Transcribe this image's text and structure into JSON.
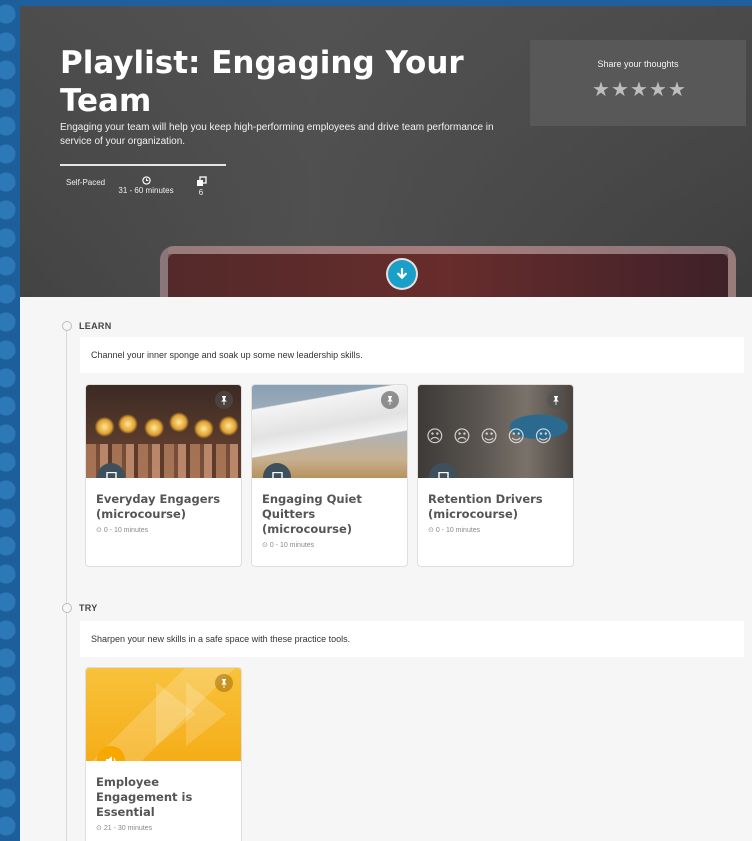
{
  "hero": {
    "title": "Playlist: Engaging Your Team",
    "description": "Engaging your team will help you keep high-performing employees and drive team performance in service of your organization.",
    "pace": "Self-Paced",
    "duration": "31 - 60 minutes",
    "item_count": "6",
    "rating_label": "Share your thoughts",
    "rating_stars": 5
  },
  "sections": [
    {
      "label": "LEARN",
      "description": "Channel your inner sponge and soak up some new leadership skills.",
      "cards": [
        {
          "title": "Everyday Engagers (microcourse)",
          "duration": "0 - 10 minutes",
          "type_icon": "laptop-icon"
        },
        {
          "title": "Engaging Quiet Quitters (microcourse)",
          "duration": "0 - 10 minutes",
          "type_icon": "laptop-icon"
        },
        {
          "title": "Retention Drivers (microcourse)",
          "duration": "0 - 10 minutes",
          "type_icon": "laptop-icon"
        }
      ]
    },
    {
      "label": "TRY",
      "description": "Sharpen your new skills in a safe space with these practice tools.",
      "cards": [
        {
          "title": "Employee Engagement is Essential",
          "duration": "21 - 30 minutes",
          "type_icon": "audio-icon"
        }
      ]
    }
  ],
  "colors": {
    "accent": "#1a9fc9",
    "card_type_badge": "#3e4f5e",
    "audio_badge": "#f6a800",
    "page_background": "#f6f6f6",
    "frame_blue": "#1c5d96"
  }
}
